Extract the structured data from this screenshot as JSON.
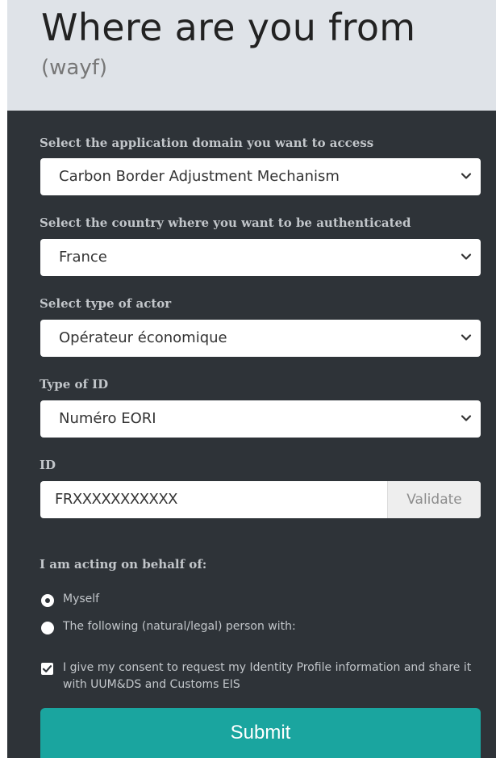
{
  "header": {
    "title": "Where are you from",
    "subtitle": "(wayf)"
  },
  "form": {
    "domain": {
      "label": "Select the application domain you want to access",
      "value": "Carbon Border Adjustment Mechanism"
    },
    "country": {
      "label": "Select the country where you want to be authenticated",
      "value": "France"
    },
    "actor": {
      "label": "Select type of actor",
      "value": "Opérateur économique"
    },
    "id_type": {
      "label": "Type of ID",
      "value": "Numéro EORI"
    },
    "id": {
      "label": "ID",
      "value": "FRXXXXXXXXXXX",
      "validate_label": "Validate"
    },
    "behalf": {
      "label": "I am acting on behalf of:",
      "options": [
        {
          "label": "Myself",
          "checked": true
        },
        {
          "label": "The following (natural/legal) person with:",
          "checked": false
        }
      ]
    },
    "consent": {
      "text": "I give my consent to request my Identity Profile information and share it with UUM&DS and Customs EIS",
      "checked": true
    },
    "submit_label": "Submit"
  },
  "colors": {
    "header_bg": "#dfe3e8",
    "panel_bg": "#2e3338",
    "submit_bg": "#1aa59f",
    "label_text": "#c2c6ca"
  },
  "icons": {
    "select_chevron": "chevron-down-icon",
    "consent_check": "checkmark-icon"
  }
}
